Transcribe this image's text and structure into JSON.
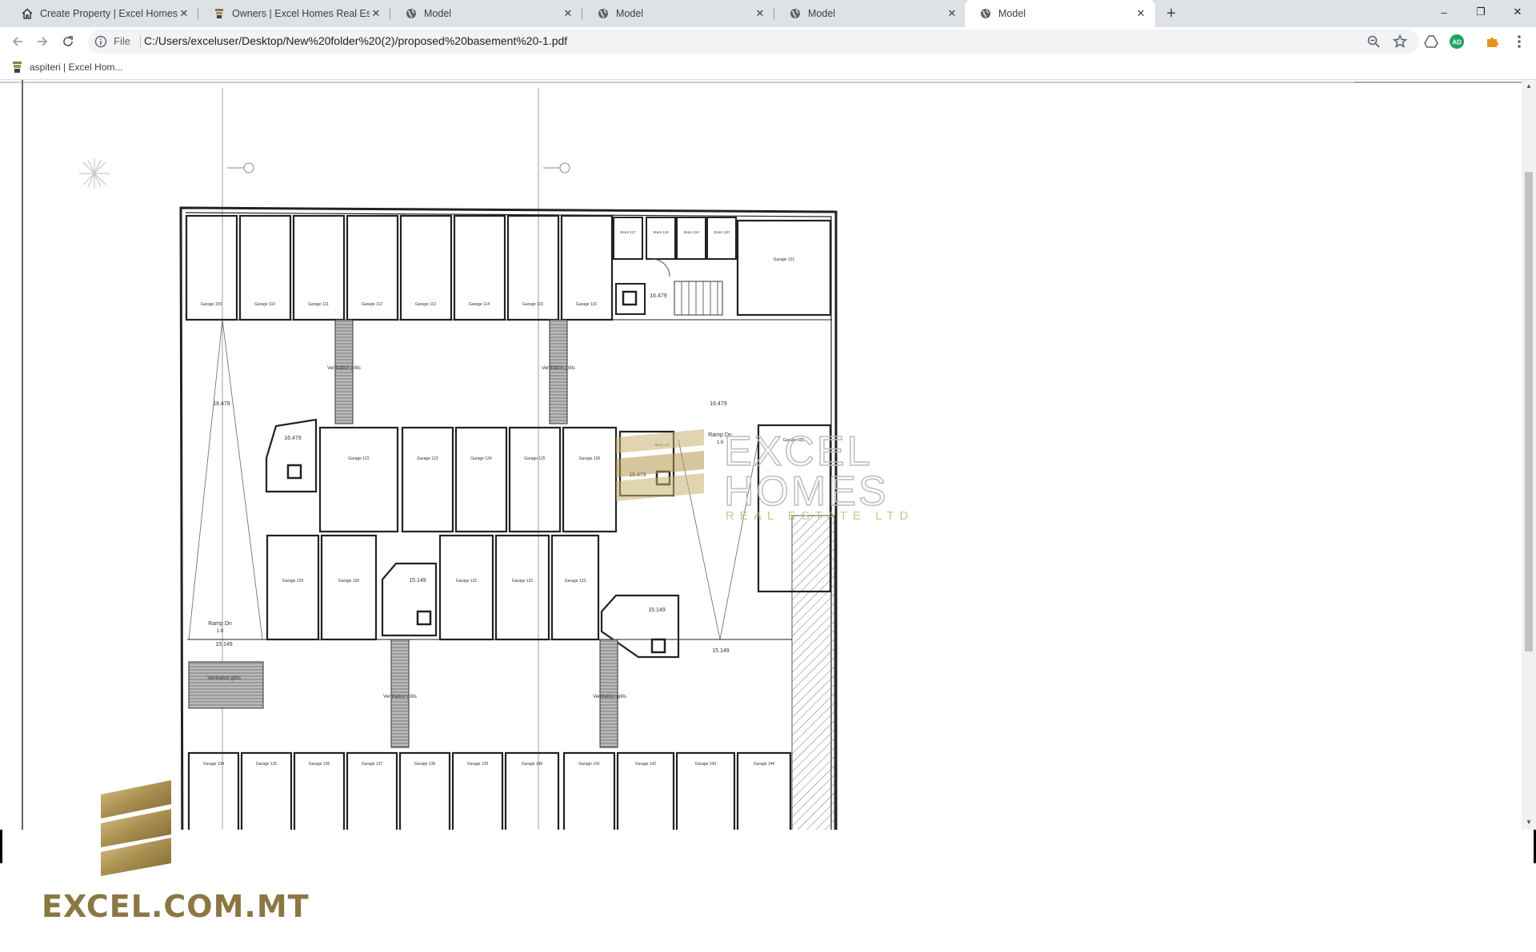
{
  "browser": {
    "tabs": [
      {
        "title": "Create Property | Excel Homes Re",
        "favicon": "home-icon",
        "active": false
      },
      {
        "title": "Owners | Excel Homes Real Estate",
        "favicon": "excel-homes-logo-icon",
        "active": false
      },
      {
        "title": "Model",
        "favicon": "globe-icon",
        "active": false
      },
      {
        "title": "Model",
        "favicon": "globe-icon",
        "active": false
      },
      {
        "title": "Model",
        "favicon": "globe-icon",
        "active": false
      },
      {
        "title": "Model",
        "favicon": "globe-icon",
        "active": true
      }
    ],
    "new_tab": "+",
    "window_controls": {
      "minimize": "–",
      "restore": "❐",
      "close": "✕"
    },
    "omnibox": {
      "scheme_label": "File",
      "url": "C:/Users/exceluser/Desktop/New%20folder%20(2)/proposed%20basement%20-1.pdf"
    },
    "profile_initials": "AD",
    "bookmark": {
      "label": "aspiteri | Excel Hom..."
    }
  },
  "drawing": {
    "garage_labels_top": [
      "Garage 109",
      "Garage 110",
      "Garage 111",
      "Garage 112",
      "Garage 113",
      "Garage 114",
      "Garage 115",
      "Garage 116"
    ],
    "store_labels": [
      "Store 117",
      "Store 118",
      "Store 119",
      "Store 120"
    ],
    "garage_labels_mid": [
      "Garage 122",
      "Garage 123",
      "Garage 124",
      "Garage 125",
      "Garage 126"
    ],
    "garage_labels_low": [
      "Garage 129",
      "Garage 130",
      "Garage 131",
      "Garage 132",
      "Garage 133"
    ],
    "garage_labels_bottom": [
      "Garage 134",
      "Garage 135",
      "Garage 136",
      "Garage 137",
      "Garage 138",
      "Garage 139",
      "Garage 140",
      "Garage 141",
      "Garage 142",
      "Garage 143",
      "Garage 144"
    ],
    "garage_121": "Garage 121",
    "garage_128": "Garage 128",
    "store_127": "Store 127",
    "ventilation": "Ventilation grills",
    "ramp_label": "Ramp Dn",
    "ramp_ratio": "1:8",
    "level_upper": "16.479",
    "level_lower": "15.149"
  },
  "watermark": {
    "line1": "EXCEL",
    "line2": "HOMES",
    "line3": "REAL ESTATE LTD"
  },
  "brand_footer": "EXCEL.COM.MT",
  "colors": {
    "gold": "#a88f4f",
    "gold_dark": "#8b7743",
    "tabstrip": "#dee1e6"
  }
}
